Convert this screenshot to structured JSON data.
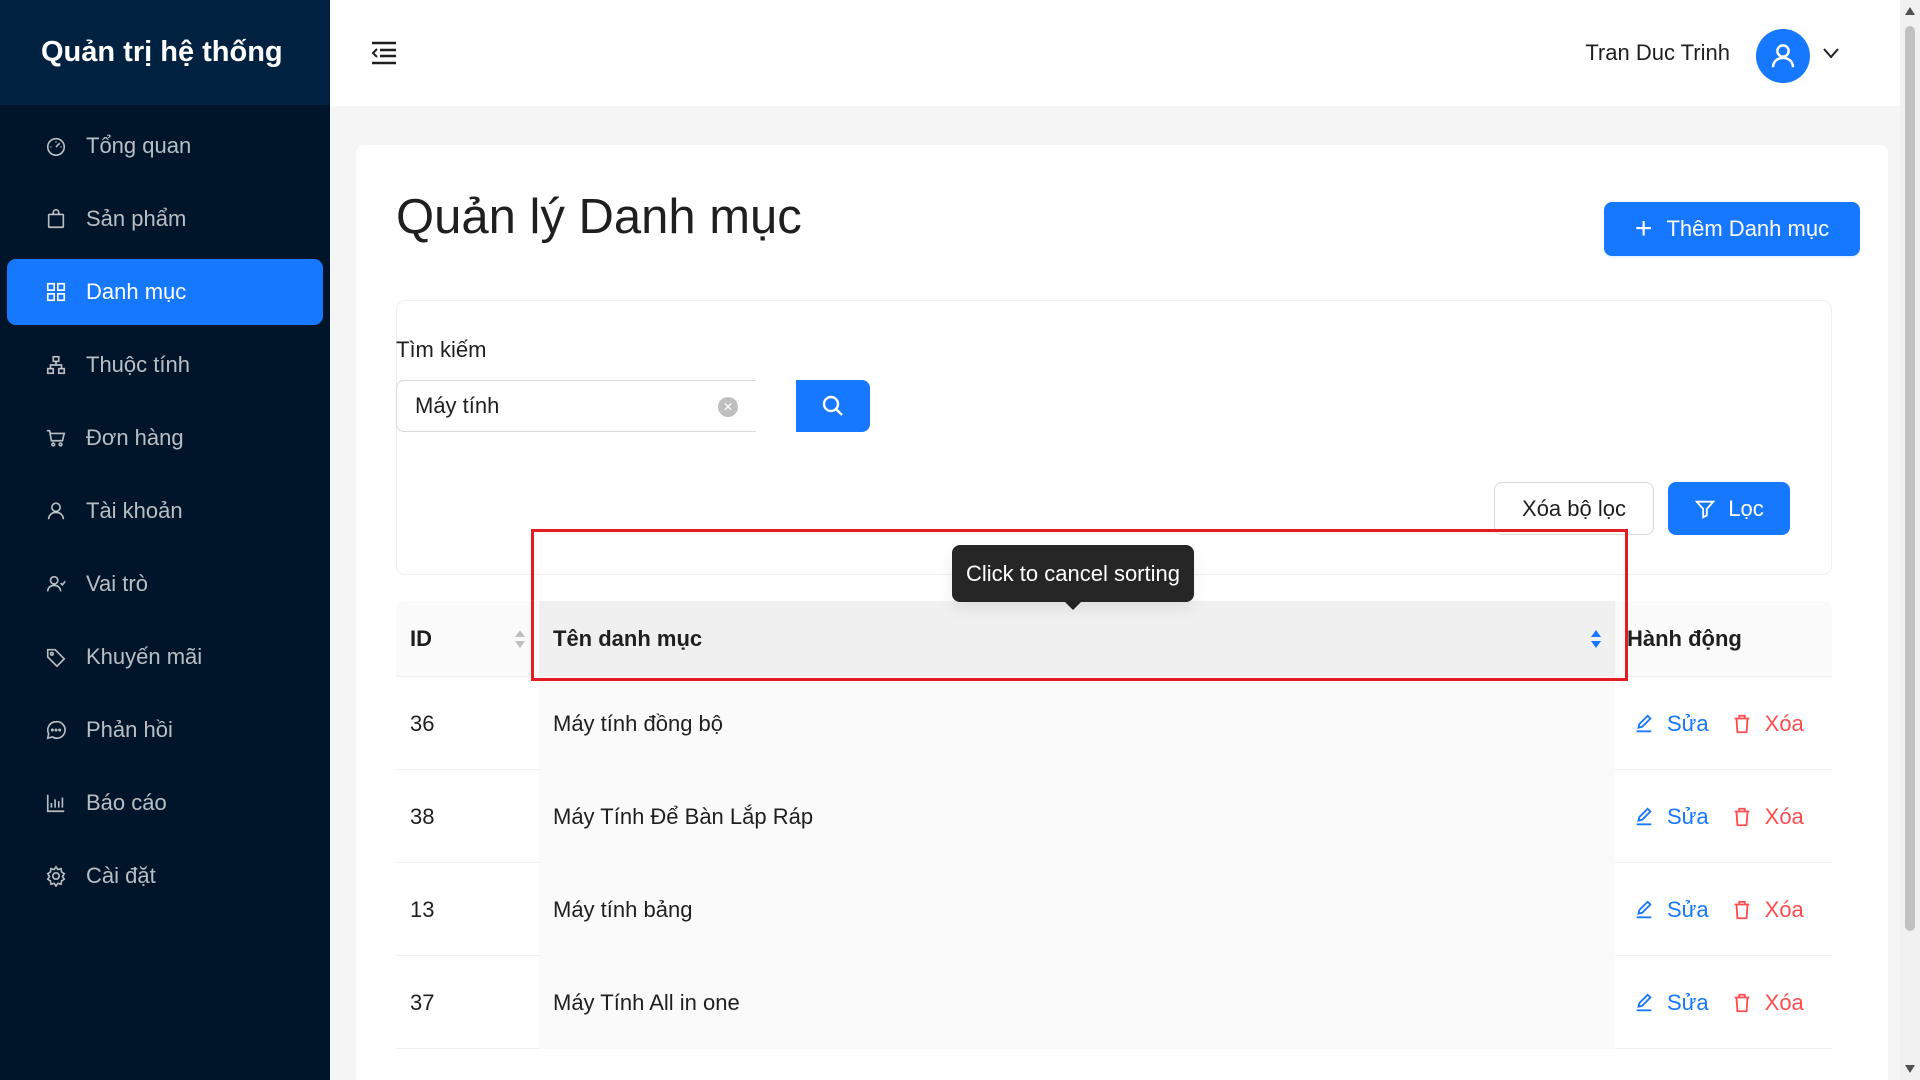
{
  "sidebar": {
    "brand": "Quản trị hệ thống",
    "items": [
      {
        "label": "Tổng quan",
        "icon": "dashboard-icon",
        "active": false
      },
      {
        "label": "Sản phẩm",
        "icon": "shopping-bag-icon",
        "active": false
      },
      {
        "label": "Danh mục",
        "icon": "grid-icon",
        "active": true
      },
      {
        "label": "Thuộc tính",
        "icon": "cluster-icon",
        "active": false
      },
      {
        "label": "Đơn hàng",
        "icon": "cart-icon",
        "active": false
      },
      {
        "label": "Tài khoản",
        "icon": "user-icon",
        "active": false
      },
      {
        "label": "Vai trò",
        "icon": "team-icon",
        "active": false
      },
      {
        "label": "Khuyến mãi",
        "icon": "tag-icon",
        "active": false
      },
      {
        "label": "Phản hồi",
        "icon": "message-icon",
        "active": false
      },
      {
        "label": "Báo cáo",
        "icon": "bar-chart-icon",
        "active": false
      },
      {
        "label": "Cài đặt",
        "icon": "settings-icon",
        "active": false
      }
    ]
  },
  "header": {
    "user_name": "Tran Duc Trinh"
  },
  "main": {
    "title": "Quản lý Danh mục",
    "add_button": "Thêm Danh mục",
    "search": {
      "label": "Tìm kiếm",
      "value": "Máy tính"
    },
    "clear_filter_button": "Xóa bộ lọc",
    "filter_button": "Lọc",
    "table": {
      "columns": [
        "ID",
        "Tên danh mục",
        "Hành động"
      ],
      "rows": [
        {
          "id": "36",
          "name": "Máy tính đồng bộ"
        },
        {
          "id": "38",
          "name": "Máy Tính Để Bàn Lắp Ráp"
        },
        {
          "id": "13",
          "name": "Máy tính bảng"
        },
        {
          "id": "37",
          "name": "Máy Tính All in one"
        }
      ],
      "edit_label": "Sửa",
      "delete_label": "Xóa"
    },
    "tooltip": "Click to cancel sorting"
  },
  "colors": {
    "primary": "#1677ff",
    "sidebar_bg": "#001529",
    "danger": "#ff4d4f",
    "highlight": "#e31b23"
  }
}
